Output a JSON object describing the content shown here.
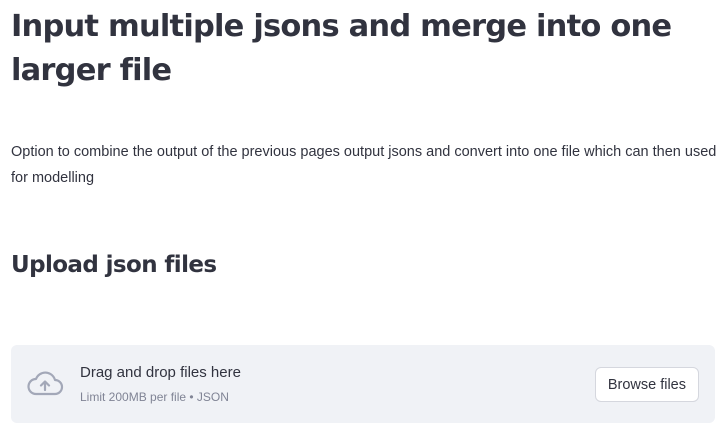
{
  "page": {
    "title": "Input multiple jsons and merge into one larger file",
    "description": "Option to combine the output of the previous pages output jsons and convert into one file which can then used for modelling",
    "subheader": "Upload json files"
  },
  "uploader": {
    "drag_text": "Drag and drop files here",
    "limit_text": "Limit 200MB per file • JSON",
    "browse_label": "Browse files",
    "icon": "cloud-upload-icon"
  },
  "colors": {
    "text": "#31333f",
    "muted": "#808495",
    "dropzone_bg": "#f0f2f6",
    "icon": "#a3a8b8"
  }
}
